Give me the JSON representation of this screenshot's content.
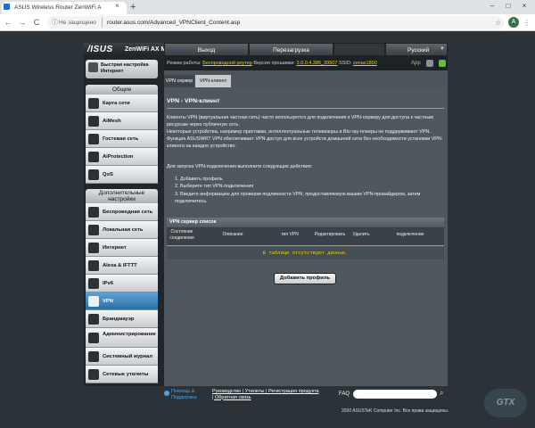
{
  "browser": {
    "tab_title": "ASUS Wireless Router ZenWiFi A",
    "tab_close": "×",
    "new_tab": "+",
    "window_controls": [
      "–",
      "□",
      "×"
    ],
    "nav": {
      "back": "←",
      "forward": "→",
      "reload": "C"
    },
    "security_label": "Не защищено",
    "url": "router.asus.com/Advanced_VPNClient_Content.asp",
    "avatar_letter": "A",
    "menu": "⋮",
    "star": "☆"
  },
  "header": {
    "logo": "/ISUS",
    "model": "ZenWiFi AX Mini",
    "logout": "Выход",
    "reboot": "Перезагрузка",
    "language": "Русский",
    "status": {
      "mode_label": "Режим работы:",
      "mode_value": "Беспроводной роутер",
      "fw_label": "Версия прошивки:",
      "fw_value": "3.0.0.4.386_39507",
      "ssid_label": "SSID:",
      "ssid_value": "zenax1800"
    },
    "app_link": "App"
  },
  "sidebar": {
    "qis_label": "Быстрая настройка Интернет",
    "general_title": "Общие",
    "general_items": [
      "Карта сети",
      "AiMesh",
      "Гостевая сеть",
      "AiProtection",
      "QoS"
    ],
    "advanced_title": "Дополнительные настройки",
    "advanced_items": [
      "Беспроводная сеть",
      "Локальная сеть",
      "Интернет",
      "Alexa & IFTTT",
      "IPv6",
      "VPN",
      "Брандмауэр",
      "Администрирование",
      "Системный журнал",
      "Сетевые утилиты"
    ]
  },
  "content": {
    "tabs": [
      "VPN сервер",
      "VPN-клиент"
    ],
    "title": "VPN - VPN-клиент",
    "paragraphs": [
      "Клиенты VPN (виртуальная частная сеть) часто используются для подключения к VPN-серверу для доступа к частным ресурсам через публичную сеть.",
      "Некоторые устройства, например приставки, интеллектуальные телевизоры и Blu-ray-плееры не поддерживают VPN.",
      "Функция ASUSWRT VPN обеспечивает VPN-доступ для всех устройств домашней сети без необходимости установки VPN-клиента на каждое устройство."
    ],
    "steps_intro": "Для запуска VPN-подключения выполните следующие действия:",
    "steps": [
      "1. Добавить профиль",
      "2. Выберите тип VPN-подключения",
      "3. Введите информацию для проверки подлинности VPN, предоставляемую вашим VPN-провайдером, затем подключитесь."
    ],
    "table": {
      "title": "VPN сервер список",
      "columns": [
        "Состояние соединения",
        "Описание",
        "тип VPN",
        "Редактировать",
        "Удалить",
        "подключение"
      ],
      "empty": "В таблице отсутствуют данные."
    },
    "add_profile": "Добавить профиль"
  },
  "footer": {
    "help": "Помощь & Поддержка",
    "links": "Руководство | Утилиты | Регистрация продукта | Обратная связь",
    "faq": "FAQ",
    "copyright": "2020 ASUSTeK Computer Inc. Все права защищены.",
    "watermark": "GTX"
  },
  "colors": {
    "accent": "#2b6ea8",
    "highlight": "#f4d100",
    "app_green": "#8fd46a"
  }
}
